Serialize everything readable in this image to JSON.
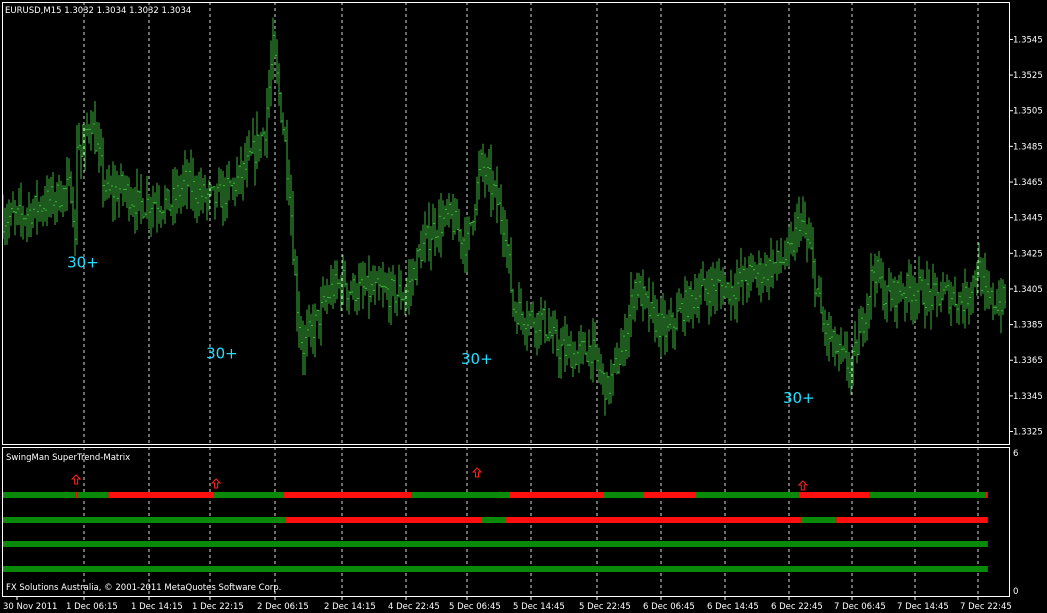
{
  "window": {
    "symbol_line": "EURUSD,M15  1.3032 1.3034 1.3032 1.3034",
    "indicator_name": "SwingMan SuperTrend-Matrix",
    "copyright": "FX Solutions Australia, © 2001-2011 MetaQuotes Software Corp."
  },
  "colors": {
    "background": "#000000",
    "candles": "#3cb33c",
    "frame": "#ffffff",
    "grid": "#ffffff",
    "bull": "#0a8a0a",
    "bear": "#ff1010",
    "arrow": "#ff2020",
    "label": "#22e0ff"
  },
  "chart_data": [
    {
      "type": "bar",
      "chart_kind": "ohlc-price",
      "title": "EURUSD,M15  1.3032 1.3034 1.3032 1.3034",
      "ylim": [
        1.3318,
        1.3566
      ],
      "y_ticks": [
        "1.3545",
        "1.3525",
        "1.3505",
        "1.3485",
        "1.3465",
        "1.3445",
        "1.3425",
        "1.3405",
        "1.3385",
        "1.3365",
        "1.3345",
        "1.3325"
      ],
      "x_ticks": [
        "30 Nov 2011",
        "1 Dec 06:15",
        "1 Dec 14:15",
        "1 Dec 22:15",
        "2 Dec 06:15",
        "2 Dec 14:15",
        "4 Dec 22:45",
        "5 Dec 06:45",
        "5 Dec 14:45",
        "5 Dec 22:45",
        "6 Dec 06:45",
        "6 Dec 14:45",
        "6 Dec 22:45",
        "7 Dec 06:45",
        "7 Dec 14:45",
        "7 Dec 22:45"
      ],
      "grid": "vertical dotted at tick positions",
      "annotations": [
        {
          "text": "30+",
          "x": "1 Dec 02:00",
          "y": 1.3417
        },
        {
          "text": "30+",
          "x": "1 Dec 22:45",
          "y": 1.3366
        },
        {
          "text": "30+",
          "x": "5 Dec 07:00",
          "y": 1.3363
        },
        {
          "text": "30+",
          "x": "6 Dec 23:00",
          "y": 1.3341
        }
      ],
      "price_path": [
        [
          "30 Nov 23:00",
          1.3445
        ],
        [
          "1 Dec 00:30",
          1.3462
        ],
        [
          "1 Dec 02:00",
          1.3428
        ],
        [
          "1 Dec 03:00",
          1.3495
        ],
        [
          "1 Dec 05:00",
          1.3478
        ],
        [
          "1 Dec 07:00",
          1.3502
        ],
        [
          "1 Dec 09:00",
          1.3458
        ],
        [
          "1 Dec 11:00",
          1.3462
        ],
        [
          "1 Dec 13:00",
          1.3452
        ],
        [
          "1 Dec 15:00",
          1.3455
        ],
        [
          "1 Dec 17:00",
          1.3452
        ],
        [
          "1 Dec 19:00",
          1.3465
        ],
        [
          "1 Dec 21:00",
          1.3458
        ],
        [
          "1 Dec 23:00",
          1.3455
        ],
        [
          "2 Dec 01:00",
          1.3462
        ],
        [
          "2 Dec 03:00",
          1.3475
        ],
        [
          "2 Dec 05:00",
          1.3495
        ],
        [
          "2 Dec 06:00",
          1.354
        ],
        [
          "2 Dec 07:15",
          1.3495
        ],
        [
          "2 Dec 08:00",
          1.346
        ],
        [
          "2 Dec 08:45",
          1.3402
        ],
        [
          "2 Dec 09:30",
          1.3372
        ],
        [
          "2 Dec 11:00",
          1.3385
        ],
        [
          "2 Dec 13:00",
          1.3405
        ],
        [
          "2 Dec 14:30",
          1.3408
        ],
        [
          "2 Dec 16:30",
          1.3412
        ],
        [
          "2 Dec 18:00",
          1.3405
        ],
        [
          "4 Dec 22:45",
          1.3402
        ],
        [
          "5 Dec 00:30",
          1.3425
        ],
        [
          "5 Dec 02:30",
          1.344
        ],
        [
          "5 Dec 04:30",
          1.3445
        ],
        [
          "5 Dec 06:45",
          1.343
        ],
        [
          "5 Dec 08:30",
          1.3475
        ],
        [
          "5 Dec 10:00",
          1.346
        ],
        [
          "5 Dec 11:30",
          1.344
        ],
        [
          "5 Dec 12:30",
          1.3395
        ],
        [
          "5 Dec 14:00",
          1.339
        ],
        [
          "5 Dec 16:00",
          1.3388
        ],
        [
          "5 Dec 18:00",
          1.3372
        ],
        [
          "5 Dec 20:00",
          1.3368
        ],
        [
          "5 Dec 22:00",
          1.3372
        ],
        [
          "6 Dec 00:00",
          1.3348
        ],
        [
          "6 Dec 02:00",
          1.3372
        ],
        [
          "6 Dec 03:30",
          1.3408
        ],
        [
          "6 Dec 05:30",
          1.339
        ],
        [
          "6 Dec 07:30",
          1.338
        ],
        [
          "6 Dec 09:30",
          1.3395
        ],
        [
          "6 Dec 11:30",
          1.3403
        ],
        [
          "6 Dec 13:30",
          1.3407
        ],
        [
          "6 Dec 15:30",
          1.3405
        ],
        [
          "6 Dec 17:30",
          1.3412
        ],
        [
          "6 Dec 19:30",
          1.3415
        ],
        [
          "6 Dec 21:30",
          1.342
        ],
        [
          "6 Dec 23:00",
          1.3425
        ],
        [
          "7 Dec 00:00",
          1.3445
        ],
        [
          "7 Dec 01:30",
          1.3425
        ],
        [
          "7 Dec 03:00",
          1.3385
        ],
        [
          "7 Dec 05:00",
          1.3368
        ],
        [
          "7 Dec 06:45",
          1.336
        ],
        [
          "7 Dec 08:00",
          1.3385
        ],
        [
          "7 Dec 09:30",
          1.3418
        ],
        [
          "7 Dec 11:00",
          1.34
        ],
        [
          "7 Dec 13:00",
          1.3405
        ],
        [
          "7 Dec 15:00",
          1.3405
        ],
        [
          "7 Dec 17:00",
          1.34
        ],
        [
          "7 Dec 19:00",
          1.3402
        ],
        [
          "7 Dec 21:00",
          1.3398
        ],
        [
          "7 Dec 22:45",
          1.3418
        ],
        [
          "7 Dec 23:45",
          1.3398
        ]
      ]
    },
    {
      "type": "heatmap",
      "chart_kind": "supertrend-matrix",
      "title": "SwingMan SuperTrend-Matrix",
      "ylim": [
        0,
        6
      ],
      "y_ticks": [
        "6",
        "0"
      ],
      "rows": [
        {
          "segments": [
            {
              "from": "30 Nov 2011",
              "to": "1 Dec 02:15",
              "state": "bull"
            },
            {
              "from": "1 Dec 02:15",
              "to": "1 Dec 03:15",
              "state": "bear"
            },
            {
              "from": "1 Dec 03:15",
              "to": "1 Dec 09:15",
              "state": "bull"
            },
            {
              "from": "1 Dec 09:15",
              "to": "1 Dec 22:45",
              "state": "bear"
            },
            {
              "from": "1 Dec 22:45",
              "to": "2 Dec 07:15",
              "state": "bull"
            },
            {
              "from": "2 Dec 07:15",
              "to": "4 Dec 23:30",
              "state": "bear"
            },
            {
              "from": "4 Dec 23:30",
              "to": "5 Dec 12:00",
              "state": "bull"
            },
            {
              "from": "5 Dec 12:00",
              "to": "5 Dec 23:30",
              "state": "bear"
            },
            {
              "from": "5 Dec 23:30",
              "to": "6 Dec 04:30",
              "state": "bull"
            },
            {
              "from": "6 Dec 04:30",
              "to": "6 Dec 11:00",
              "state": "bear"
            },
            {
              "from": "6 Dec 11:00",
              "to": "7 Dec 00:00",
              "state": "bull"
            },
            {
              "from": "7 Dec 00:00",
              "to": "7 Dec 09:00",
              "state": "bear"
            },
            {
              "from": "7 Dec 09:00",
              "to": "7 Dec 23:45",
              "state": "bull"
            },
            {
              "from": "7 Dec 23:45",
              "to": "8 Dec 00:00",
              "state": "bear"
            }
          ]
        },
        {
          "segments": [
            {
              "from": "30 Nov 2011",
              "to": "2 Dec 07:30",
              "state": "bull"
            },
            {
              "from": "2 Dec 07:30",
              "to": "5 Dec 08:30",
              "state": "bear"
            },
            {
              "from": "5 Dec 08:30",
              "to": "5 Dec 11:30",
              "state": "bull"
            },
            {
              "from": "5 Dec 11:30",
              "to": "7 Dec 00:15",
              "state": "bear"
            },
            {
              "from": "7 Dec 00:15",
              "to": "7 Dec 04:45",
              "state": "bull"
            },
            {
              "from": "7 Dec 04:45",
              "to": "8 Dec 00:00",
              "state": "bear"
            }
          ]
        },
        {
          "segments": [
            {
              "from": "30 Nov 2011",
              "to": "8 Dec 00:00",
              "state": "bull"
            }
          ]
        },
        {
          "segments": [
            {
              "from": "30 Nov 2011",
              "to": "8 Dec 00:00",
              "state": "bull"
            }
          ]
        }
      ],
      "arrows": [
        {
          "x": "1 Dec 02:30",
          "direction": "up"
        },
        {
          "x": "1 Dec 23:00",
          "direction": "up"
        },
        {
          "x": "5 Dec 08:00",
          "direction": "up"
        },
        {
          "x": "7 Dec 00:30",
          "direction": "up"
        }
      ]
    }
  ]
}
